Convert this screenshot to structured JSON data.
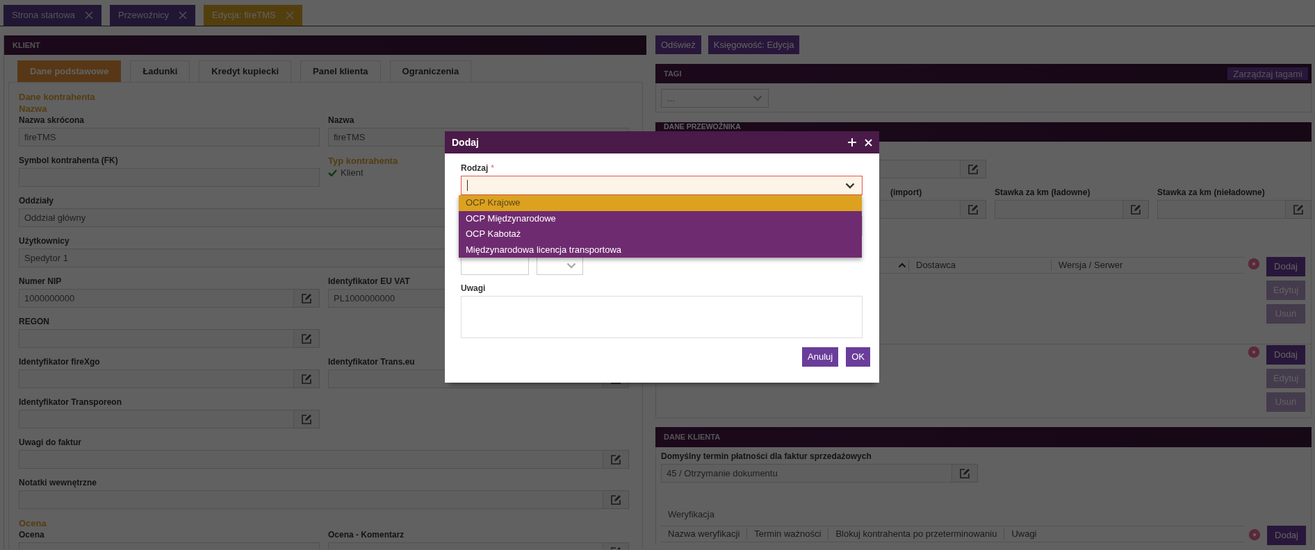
{
  "page_tabs": [
    {
      "label": "Strona startowa",
      "selected": false
    },
    {
      "label": "Przewoźnicy",
      "selected": false
    },
    {
      "label": "Edycja: fireTMS",
      "selected": true
    }
  ],
  "client_panel": {
    "title": "KLIENT",
    "tabs": [
      {
        "label": "Dane podstawowe",
        "selected": true
      },
      {
        "label": "Ładunki",
        "selected": false
      },
      {
        "label": "Kredyt kupiecki",
        "selected": false
      },
      {
        "label": "Panel klienta",
        "selected": false
      },
      {
        "label": "Ograniczenia",
        "selected": false
      }
    ],
    "items": [
      {
        "kind": "heading",
        "text": "Dane kontrahenta"
      },
      {
        "kind": "heading",
        "text": "Nazwa"
      },
      {
        "kind": "row",
        "cells": [
          {
            "kind": "field",
            "label": "Nazwa skrócona",
            "value": "fireTMS",
            "editable": false
          },
          {
            "kind": "field",
            "label": "Nazwa",
            "value": "fireTMS",
            "editable": false
          }
        ]
      },
      {
        "kind": "row",
        "cells": [
          {
            "kind": "field",
            "label": "Symbol kontrahenta (FK)",
            "editable": false
          },
          {
            "kind": "checklist",
            "label": "Typ kontrahenta",
            "options": [
              {
                "label": "Klient",
                "checked": true
              }
            ]
          }
        ]
      },
      {
        "kind": "row",
        "cells": [
          {
            "kind": "wide_field",
            "label": "Oddziały",
            "value": "Oddział główny",
            "editable": false
          }
        ]
      },
      {
        "kind": "row",
        "cells": [
          {
            "kind": "wide_field",
            "label": "Użytkownicy",
            "value": "Spedytor 1",
            "editable": false
          }
        ]
      },
      {
        "kind": "row",
        "cells": [
          {
            "kind": "field",
            "label": "Numer NIP",
            "value": "1000000000",
            "editable": true
          },
          {
            "kind": "field",
            "label": "Identyfikator EU VAT",
            "value": "PL1000000000",
            "editable": false
          }
        ]
      },
      {
        "kind": "row",
        "cells": [
          {
            "kind": "field",
            "label": "REGON",
            "editable": true
          }
        ]
      },
      {
        "kind": "row",
        "cells": [
          {
            "kind": "field",
            "label": "Identyfikator fireXgo",
            "editable": true
          },
          {
            "kind": "field",
            "label": "Identyfikator Trans.eu",
            "editable": true
          }
        ]
      },
      {
        "kind": "row",
        "cells": [
          {
            "kind": "field",
            "label": "Identyfikator Transporeon",
            "editable": true
          }
        ]
      },
      {
        "kind": "row",
        "cells": [
          {
            "kind": "wide_field",
            "label": "Uwagi do faktur",
            "editable": true
          }
        ]
      },
      {
        "kind": "row",
        "cells": [
          {
            "kind": "wide_field",
            "label": "Notatki wewnętrzne",
            "editable": true
          }
        ]
      },
      {
        "kind": "heading",
        "text": "Ocena"
      },
      {
        "kind": "row",
        "cells": [
          {
            "kind": "field",
            "label": "Ocena",
            "editable": false
          },
          {
            "kind": "field",
            "label": "Ocena - Komentarz",
            "editable": true
          }
        ]
      }
    ]
  },
  "actions": [
    "Odśwież",
    "Księgowość: Edycja"
  ],
  "tags_panel": {
    "title": "TAGI",
    "manage_button": "Zarządzaj tagami",
    "select_value": "..."
  },
  "carrier_panel": {
    "title": "DANE PRZEWOŹNIKA",
    "rows": [
      {
        "cells": [
          {
            "editable": true
          }
        ]
      },
      {
        "cells": [
          {
            "label": "(import)",
            "editable": true
          },
          {
            "label": "Stawka za km (ładowne)",
            "editable": true
          },
          {
            "label": "Stawka za km (nieładowne)",
            "editable": true
          }
        ]
      }
    ],
    "grids": [
      {
        "columns": [
          {
            "kind": "sort",
            "sorted_ascending": true
          },
          {
            "kind": "text",
            "label": "Dostawca"
          },
          {
            "kind": "text",
            "label": "Wersja / Serwer"
          }
        ],
        "buttons": [
          {
            "label": "Dodaj",
            "disabled": false
          },
          {
            "label": "Edytuj",
            "disabled": true
          },
          {
            "label": "Usuń",
            "disabled": true
          }
        ]
      },
      {
        "buttons": [
          {
            "label": "Dodaj",
            "disabled": false
          },
          {
            "label": "Edytuj",
            "disabled": true
          },
          {
            "label": "Usuń",
            "disabled": true
          }
        ]
      }
    ]
  },
  "client_data_panel": {
    "title": "DANE KLIENTA",
    "field": {
      "label": "Domyślny termin płatności dla faktur sprzedażowych",
      "value": "45 / Otrzymanie dokumentu",
      "editable": true
    },
    "verification": {
      "title": "Weryfikacja",
      "columns": [
        "Nazwa weryfikacji",
        "Termin ważności",
        "Blokuj kontrahenta po przeterminowaniu",
        "Uwagi"
      ],
      "buttons": [
        {
          "label": "Dodaj",
          "disabled": false
        }
      ]
    }
  },
  "dialog": {
    "title": "Dodaj",
    "fields": [
      {
        "kind": "select",
        "label": "Rodzaj",
        "required_mark": "*",
        "focused": true,
        "expanded": true,
        "options": [
          {
            "label": "OCP Krajowe",
            "selected": true
          },
          {
            "label": "OCP Międzynarodowe",
            "selected": false
          },
          {
            "label": "OCP Kabotaż",
            "selected": false
          },
          {
            "label": "Międzynarodowa licencja transportowa",
            "selected": false
          }
        ]
      },
      {
        "kind": "input"
      },
      {
        "kind": "input_select"
      },
      {
        "kind": "textarea",
        "label": "Uwagi"
      }
    ],
    "buttons": [
      "Anuluj",
      "OK"
    ]
  }
}
